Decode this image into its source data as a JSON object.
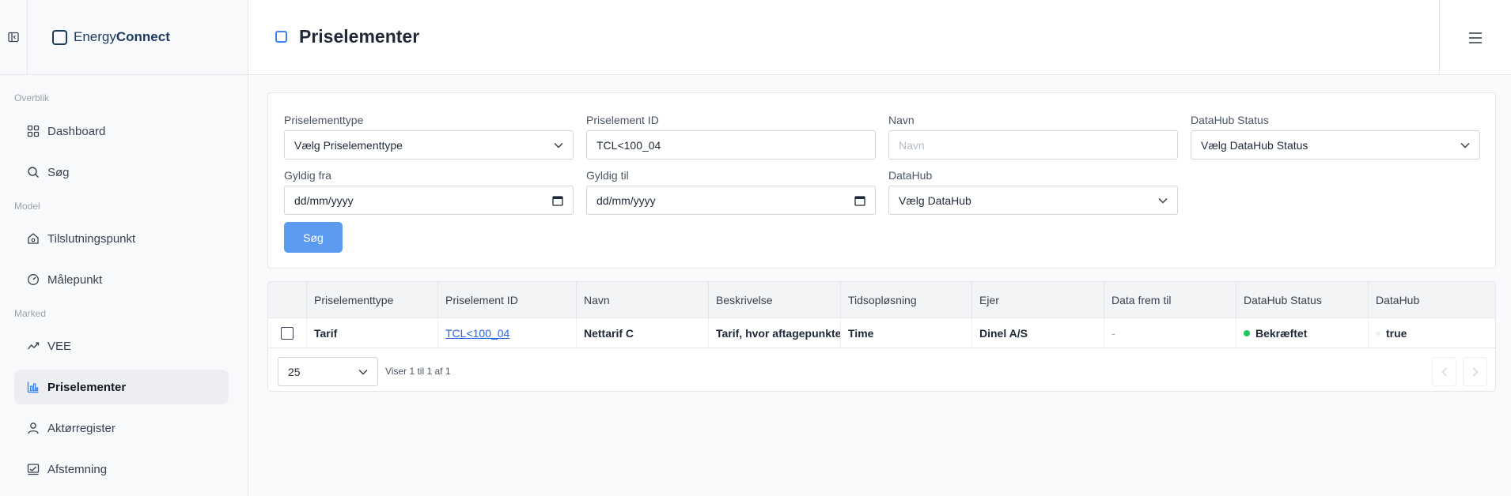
{
  "brand": {
    "light": "Energy",
    "bold": "Connect"
  },
  "sidebar": {
    "sections": [
      {
        "label": "Overblik"
      },
      {
        "label": "Model"
      },
      {
        "label": "Marked"
      }
    ],
    "items": [
      {
        "label": "Dashboard",
        "icon": "grid-icon"
      },
      {
        "label": "Søg",
        "icon": "search-icon"
      },
      {
        "label": "Tilslutningspunkt",
        "icon": "house-icon"
      },
      {
        "label": "Målepunkt",
        "icon": "gauge-icon"
      },
      {
        "label": "VEE",
        "icon": "trend-icon"
      },
      {
        "label": "Priselementer",
        "icon": "chart-icon",
        "active": true
      },
      {
        "label": "Aktørregister",
        "icon": "user-icon"
      },
      {
        "label": "Afstemning",
        "icon": "check-chart-icon"
      }
    ]
  },
  "header": {
    "title": "Priselementer"
  },
  "filters": {
    "type": {
      "label": "Priselementtype",
      "value": "Vælg Priselementtype"
    },
    "id": {
      "label": "Priselement ID",
      "value": "TCL<100_04"
    },
    "name": {
      "label": "Navn",
      "placeholder": "Navn"
    },
    "status": {
      "label": "DataHub Status",
      "value": "Vælg DataHub Status"
    },
    "valid_from": {
      "label": "Gyldig fra",
      "value": "dd/mm/yyyy"
    },
    "valid_to": {
      "label": "Gyldig til",
      "value": "dd/mm/yyyy"
    },
    "datahub": {
      "label": "DataHub",
      "value": "Vælg DataHub"
    },
    "search_label": "Søg"
  },
  "table": {
    "columns": [
      "Priselementtype",
      "Priselement ID",
      "Navn",
      "Beskrivelse",
      "Tidsopløsning",
      "Ejer",
      "Data frem til",
      "DataHub Status",
      "DataHub"
    ],
    "rows": [
      {
        "type": "Tarif",
        "id": "TCL<100_04",
        "name": "Nettarif C",
        "description": "Tarif, hvor aftagepunktet",
        "resolution": "Time",
        "owner": "Dinel A/S",
        "data_until": "-",
        "status": "Bekræftet",
        "datahub": "true"
      }
    ],
    "page_size": "25",
    "summary": "Viser 1 til 1 af 1"
  },
  "colors": {
    "accent": "#5b9bef",
    "status_ok": "#22c55e",
    "brand": "#1e3a5f"
  }
}
